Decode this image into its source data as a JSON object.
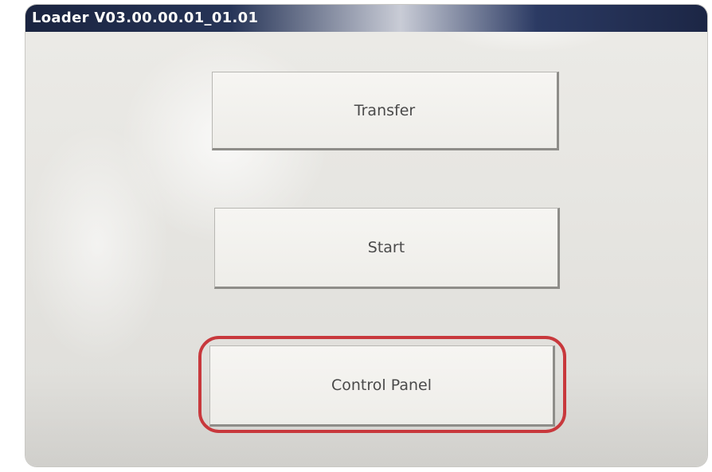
{
  "window": {
    "title": "Loader V03.00.00.01_01.01"
  },
  "buttons": {
    "transfer": "Transfer",
    "start": "Start",
    "control_panel": "Control Panel"
  },
  "highlight": {
    "target": "control-panel-button",
    "color": "#c8383c"
  }
}
